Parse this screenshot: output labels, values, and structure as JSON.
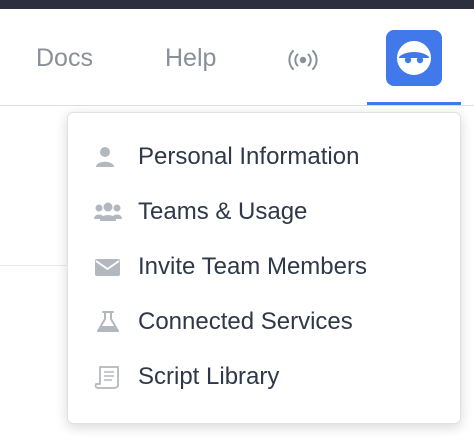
{
  "nav": {
    "links": [
      {
        "label": "Docs",
        "icon": null
      },
      {
        "label": "Help",
        "icon": null
      }
    ],
    "live_icon": "broadcast-icon",
    "avatar_icon": "avatar-face-icon"
  },
  "menu": {
    "items": [
      {
        "label": "Personal Information",
        "icon": "user-icon"
      },
      {
        "label": "Teams & Usage",
        "icon": "team-icon"
      },
      {
        "label": "Invite Team Members",
        "icon": "envelope-icon"
      },
      {
        "label": "Connected Services",
        "icon": "flask-icon"
      },
      {
        "label": "Script Library",
        "icon": "script-icon"
      }
    ]
  },
  "colors": {
    "accent": "#4178ea",
    "topbar": "#2b2f3e",
    "nav_text": "#8a9098",
    "menu_text": "#2e3849",
    "icon_gray": "#b3b8bf"
  }
}
